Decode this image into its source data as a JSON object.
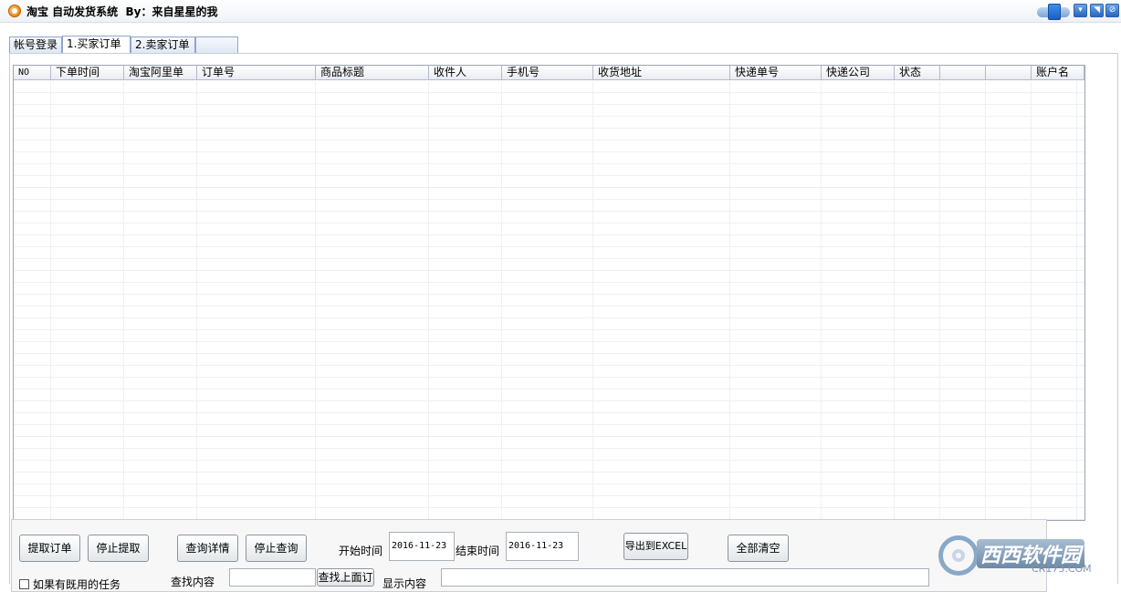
{
  "window": {
    "title": "淘宝 自动发货系统  By：来自星星的我"
  },
  "tabs": [
    {
      "label": "帐号登录"
    },
    {
      "label": "1.买家订单"
    },
    {
      "label": "2.卖家订单"
    },
    {
      "label": ""
    }
  ],
  "grid": {
    "columns": [
      "NO",
      "下单时间",
      "淘宝阿里单",
      "订单号",
      "商品标题",
      "收件人",
      "手机号",
      "收货地址",
      "快递单号",
      "快递公司",
      "状态",
      "",
      "",
      "账户名"
    ]
  },
  "controls": {
    "fetch_orders": "提取订单",
    "stop_fetch": "停止提取",
    "query_detail": "查询详情",
    "stop_query": "停止查询",
    "start_time_label": "开始时间",
    "start_time_value": "2016-11-23",
    "end_time_label": "结束时间",
    "end_time_value": "2016-11-23",
    "export_excel": "导出到EXCEL",
    "clear_all": "全部清空",
    "checkbox_label": "如果有既用的任务",
    "search_label": "查找内容",
    "search_value": "",
    "search_button": "查找上面订",
    "display_label": "显示内容",
    "display_value": ""
  },
  "watermark": {
    "brand": "西西软件园",
    "site": "CR173.COM"
  },
  "colors": {
    "accent": "#2a66c0",
    "border": "#9aa4b1"
  }
}
